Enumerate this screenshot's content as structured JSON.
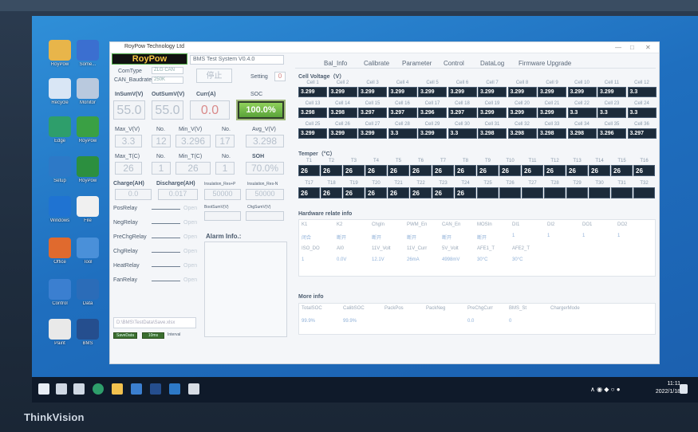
{
  "monitor": {
    "brand": "ThinkVision"
  },
  "desktop": {
    "icons": [
      {
        "label": "RoyPow",
        "color": "#e8b54a"
      },
      {
        "label": "Some...",
        "color": "#3b6fd0"
      },
      {
        "label": "Recycle",
        "color": "#d9e6f5"
      },
      {
        "label": "Monitor",
        "color": "#b9c9de"
      },
      {
        "label": "Edge",
        "color": "#2e9e6b"
      },
      {
        "label": "RoyPow",
        "color": "#3aa044"
      },
      {
        "label": "Setup",
        "color": "#2d79c7"
      },
      {
        "label": "RoyPow",
        "color": "#2c8f3f"
      },
      {
        "label": "Windows",
        "color": "#1f73d2"
      },
      {
        "label": "File",
        "color": "#f0f0f0"
      },
      {
        "label": "Office",
        "color": "#e06a2e"
      },
      {
        "label": "Tool",
        "color": "#4a90d9"
      },
      {
        "label": "Control",
        "color": "#3b7fd0"
      },
      {
        "label": "Data",
        "color": "#2b6cb8"
      },
      {
        "label": "Paint",
        "color": "#e9e9e9"
      },
      {
        "label": "BMS",
        "color": "#254e8e"
      }
    ]
  },
  "taskbar": {
    "time": "11:11",
    "date": "2022/1/18"
  },
  "app": {
    "title": "RoyPow Technology Ltd",
    "logo": "RoyPow",
    "header": "BMS Test System V0.4.0",
    "comtype_label": "ComType",
    "comtype_value": "ZLG CAN",
    "can_baudrate_label": "CAN_Baudrate",
    "can_baudrate_value": "250K",
    "stop_button": "停止",
    "setting_label": "Setting",
    "setting_value": "0",
    "tabs": [
      "Bal_Info",
      "Calibrate",
      "Parameter",
      "Control",
      "DataLog",
      "Firmware Upgrade"
    ],
    "volts": {
      "insum_label": "InSumV(V)",
      "outsum_label": "OutSumV(V)",
      "curr_label": "Curr(A)",
      "soc_label": "SOC",
      "insum": "55.0",
      "outsum": "55.0",
      "curr": "0.0",
      "soc": "100.0%"
    },
    "maxmin": {
      "maxv_label": "Max_V(V)",
      "no1_label": "No.",
      "minv_label": "Min_V(V)",
      "no2_label": "No.",
      "avgv_label": "Avg_V(V)",
      "maxv": "3.3",
      "no1": "12",
      "minv": "3.296",
      "no2": "17",
      "avgv": "3.298"
    },
    "temps": {
      "maxt_label": "Max_T(C)",
      "no1_label": "No.",
      "mint_label": "Min_T(C)",
      "no2_label": "No.",
      "soh_label": "SOH",
      "maxt": "26",
      "no1": "1",
      "mint": "26",
      "no2": "1",
      "soh": "70.0%"
    },
    "capacity": {
      "charge_label": "Charge(AH)",
      "discharge_label": "Discharge(AH)",
      "insulation_pos_label": "Insulation_Res+P",
      "insulation_neg_label": "Insulation_Res-N",
      "charge": "0.0",
      "discharge": "0.017",
      "ins_pos": "50000",
      "ins_neg": "50000"
    },
    "relays": {
      "boot_label": "BootSumV(V)",
      "chg_label": "ChgSumV(V)",
      "items": [
        "PosRelay",
        "NegRelay",
        "PreChgRelay",
        "ChgRelay",
        "HeatRelay",
        "FanRelay"
      ],
      "state": "Open"
    },
    "alarm_label": "Alarm Info.:",
    "save_path": "D:\\BMS\\TestData\\Save.xlsx",
    "footer_btn1": "SaveData",
    "footer_btn2": "10ms",
    "footer_label": "Interval",
    "cell_voltage_title": "Cell Voltage（V）",
    "cells": {
      "row1_hdr": [
        "Cell 1",
        "Cell 2",
        "Cell 3",
        "Cell 4",
        "Cell 5",
        "Cell 6",
        "Cell 7",
        "Cell 8",
        "Cell 9",
        "Cell 10",
        "Cell 11",
        "Cell 12"
      ],
      "row1_val": [
        "3.299",
        "3.299",
        "3.299",
        "3.299",
        "3.299",
        "3.299",
        "3.299",
        "3.299",
        "3.299",
        "3.299",
        "3.299",
        "3.3"
      ],
      "row2_hdr": [
        "Cell 13",
        "Cell 14",
        "Cell 15",
        "Cell 16",
        "Cell 17",
        "Cell 18",
        "Cell 19",
        "Cell 20",
        "Cell 21",
        "Cell 22",
        "Cell 23",
        "Cell 24"
      ],
      "row2_val": [
        "3.298",
        "3.298",
        "3.297",
        "3.297",
        "3.296",
        "3.297",
        "3.299",
        "3.299",
        "3.299",
        "3.3",
        "3.3",
        "3.3"
      ],
      "row3_hdr": [
        "Cell 25",
        "Cell 26",
        "Cell 27",
        "Cell 28",
        "Cell 29",
        "Cell 30",
        "Cell 31",
        "Cell 32",
        "Cell 33",
        "Cell 34",
        "Cell 35",
        "Cell 36"
      ],
      "row3_val": [
        "3.299",
        "3.299",
        "3.299",
        "3.3",
        "3.299",
        "3.3",
        "3.298",
        "3.298",
        "3.298",
        "3.298",
        "3.296",
        "3.297"
      ]
    },
    "temper_title": "Temper（°C）",
    "temper": {
      "row1_hdr": [
        "T1",
        "T2",
        "T3",
        "T4",
        "T5",
        "T6",
        "T7",
        "T8",
        "T9",
        "T10",
        "T11",
        "T12",
        "T13",
        "T14",
        "T15",
        "T16"
      ],
      "row1_val": [
        "26",
        "26",
        "26",
        "26",
        "26",
        "26",
        "26",
        "26",
        "26",
        "26",
        "26",
        "26",
        "26",
        "26",
        "26",
        "26"
      ],
      "row2_hdr": [
        "T17",
        "T18",
        "T19",
        "T20",
        "T21",
        "T22",
        "T23",
        "T24",
        "T25",
        "T26",
        "T27",
        "T28",
        "T29",
        "T30",
        "T31",
        "T32"
      ],
      "row2_val": [
        "26",
        "26",
        "26",
        "26",
        "26",
        "26",
        "26",
        "26",
        "",
        "",
        "",
        "",
        "",
        "",
        "",
        ""
      ]
    },
    "hardware_title": "Hardware relate info",
    "hardware": {
      "row1": [
        "K1",
        "K2",
        "ChgIn",
        "PWM_En",
        "CAN_En",
        "MOSIn",
        "DI1",
        "DI2",
        "DO1",
        "DO2"
      ],
      "row2": [
        "闭合",
        "断开",
        "断开",
        "断开",
        "断开",
        "断开",
        "1",
        "1",
        "1",
        "1"
      ],
      "row3": [
        "ISO_DO",
        "AI0",
        "11V_Volt",
        "11V_Curr",
        "5V_Volt",
        "AFE1_T",
        "AFE2_T"
      ],
      "row4": [
        "1",
        "0.0V",
        "12.1V",
        "26mA",
        "4998mV",
        "30°C",
        "30°C"
      ]
    },
    "more_title": "More info",
    "more": {
      "hdr": [
        "TotalSOC",
        "CalibSOC",
        "PackPos",
        "PackNeg",
        "PreChgCurr",
        "BMS_St",
        "ChargerMode"
      ],
      "val": [
        "99.9%",
        "99.9%",
        "",
        "",
        "0.0",
        "0",
        ""
      ]
    }
  }
}
